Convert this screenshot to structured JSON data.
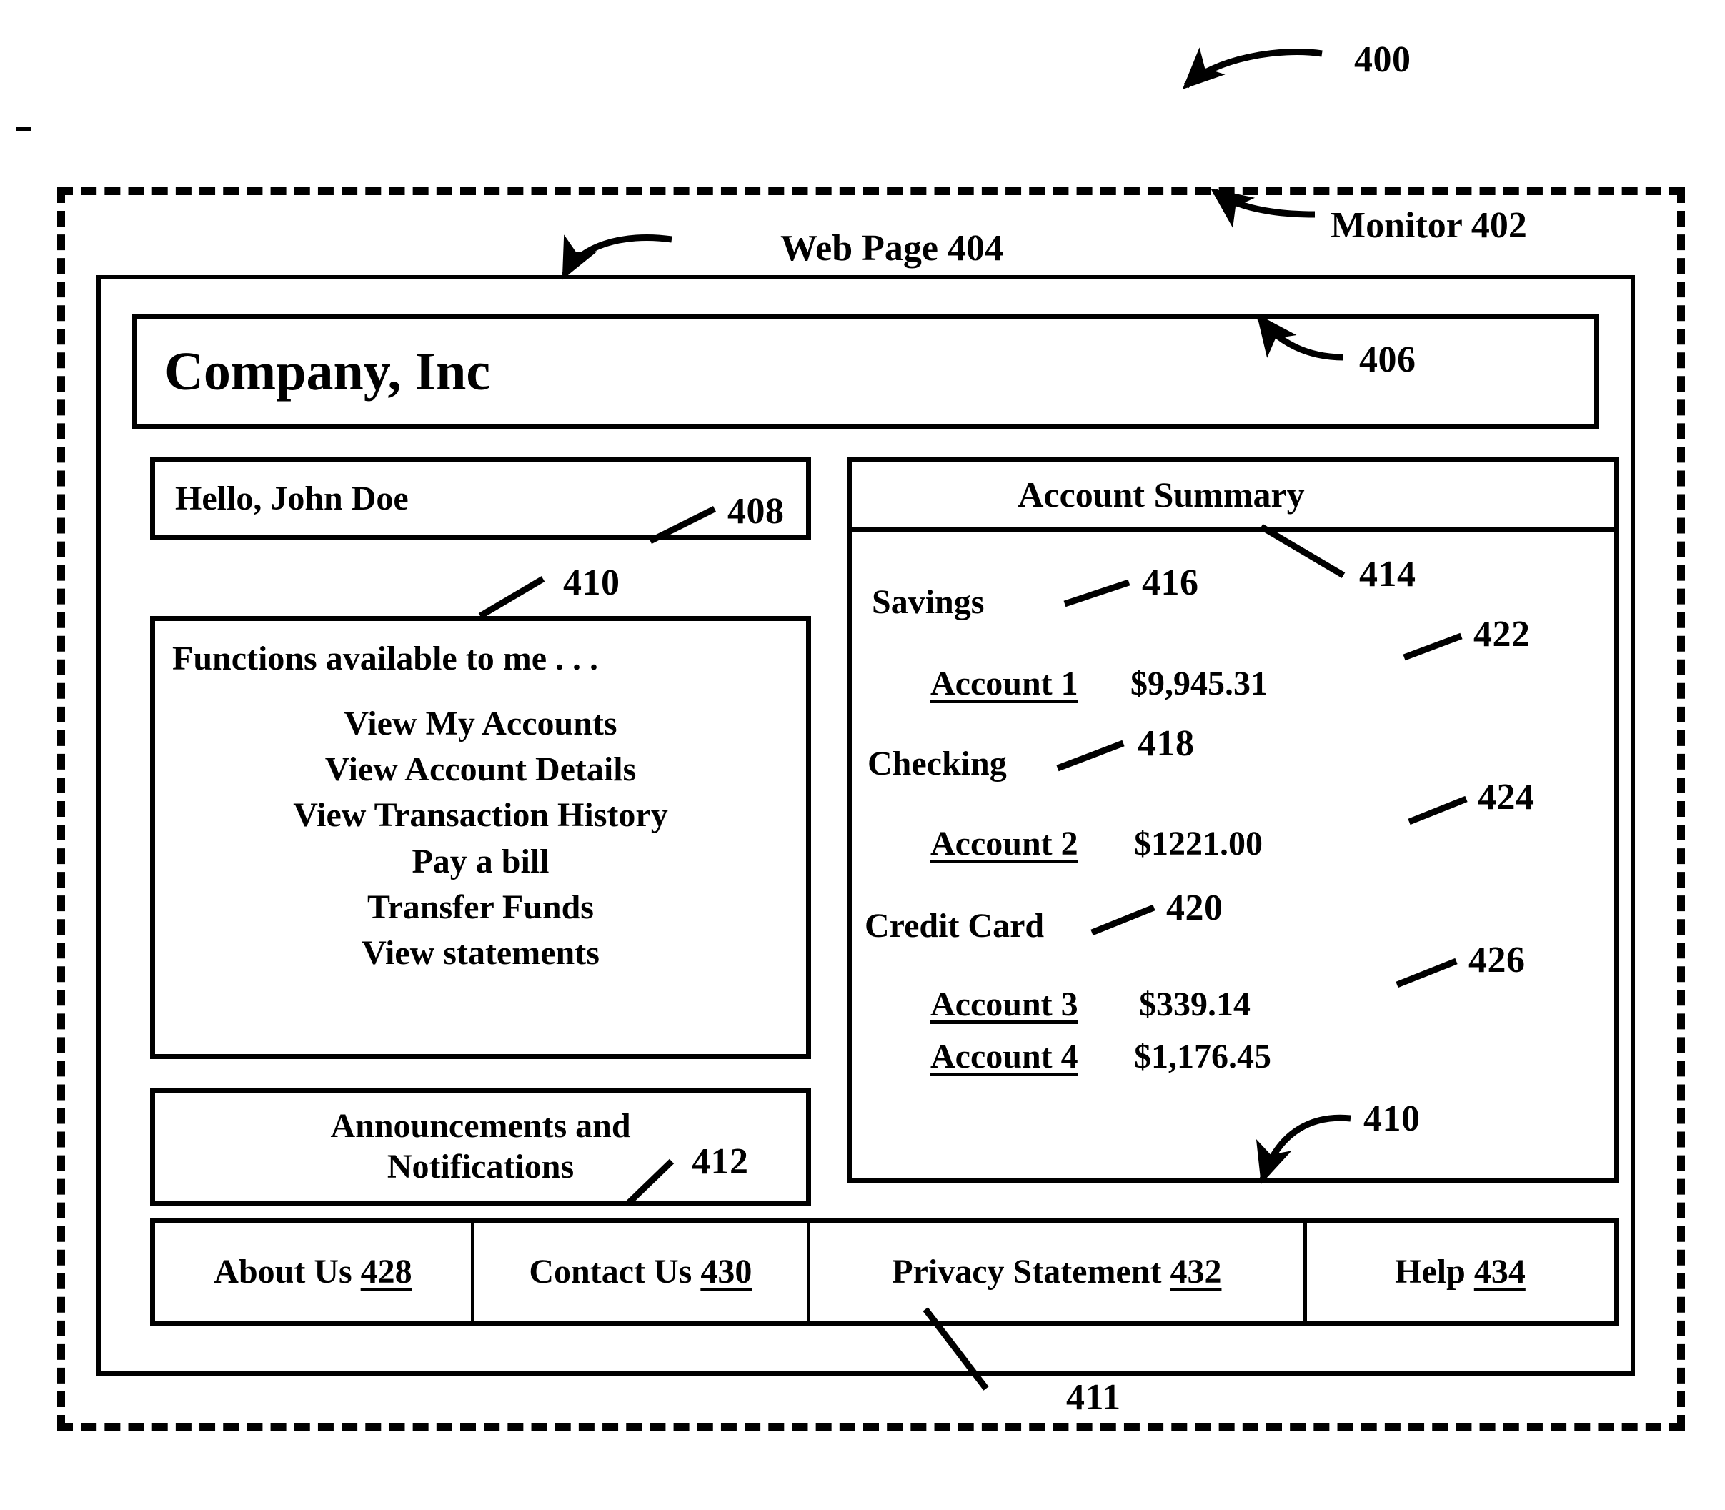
{
  "figure": {
    "number": "400",
    "monitor_label": "Monitor 402",
    "webpage_label": "Web Page 404",
    "banner_ref": "406",
    "greeting_ref": "408",
    "functions_ref": "410",
    "footer_ref": "411",
    "announcements_ref": "412",
    "summary_ref": "414",
    "savings_ref": "416",
    "checking_ref": "418",
    "credit_card_ref": "420",
    "balance1_ref": "422",
    "balance2_ref": "424",
    "balance3_ref": "426",
    "summary_bottom_ref": "410"
  },
  "banner": {
    "company_name": "Company, Inc"
  },
  "greeting": {
    "text": "Hello, John Doe"
  },
  "functions": {
    "heading": "Functions available to me . . .",
    "items": [
      "View My Accounts",
      "View Account Details",
      "View Transaction History",
      "Pay a bill",
      "Transfer Funds",
      "View statements"
    ]
  },
  "announcements": {
    "line1": "Announcements and",
    "line2": "Notifications"
  },
  "account_summary": {
    "heading": "Account Summary",
    "groups": [
      {
        "type": "Savings",
        "accounts": [
          {
            "name": "Account 1",
            "balance": "$9,945.31"
          }
        ]
      },
      {
        "type": "Checking",
        "accounts": [
          {
            "name": "Account 2",
            "balance": "$1221.00"
          }
        ]
      },
      {
        "type": "Credit Card",
        "accounts": [
          {
            "name": "Account 3",
            "balance": "$339.14"
          },
          {
            "name": "Account 4",
            "balance": "$1,176.45"
          }
        ]
      }
    ]
  },
  "footer": {
    "links": [
      {
        "label": "About Us",
        "ref": "428"
      },
      {
        "label": "Contact Us",
        "ref": "430"
      },
      {
        "label": "Privacy Statement",
        "ref": "432"
      },
      {
        "label": "Help",
        "ref": "434"
      }
    ]
  },
  "colors": {
    "ink": "#000000",
    "paper": "#ffffff"
  }
}
